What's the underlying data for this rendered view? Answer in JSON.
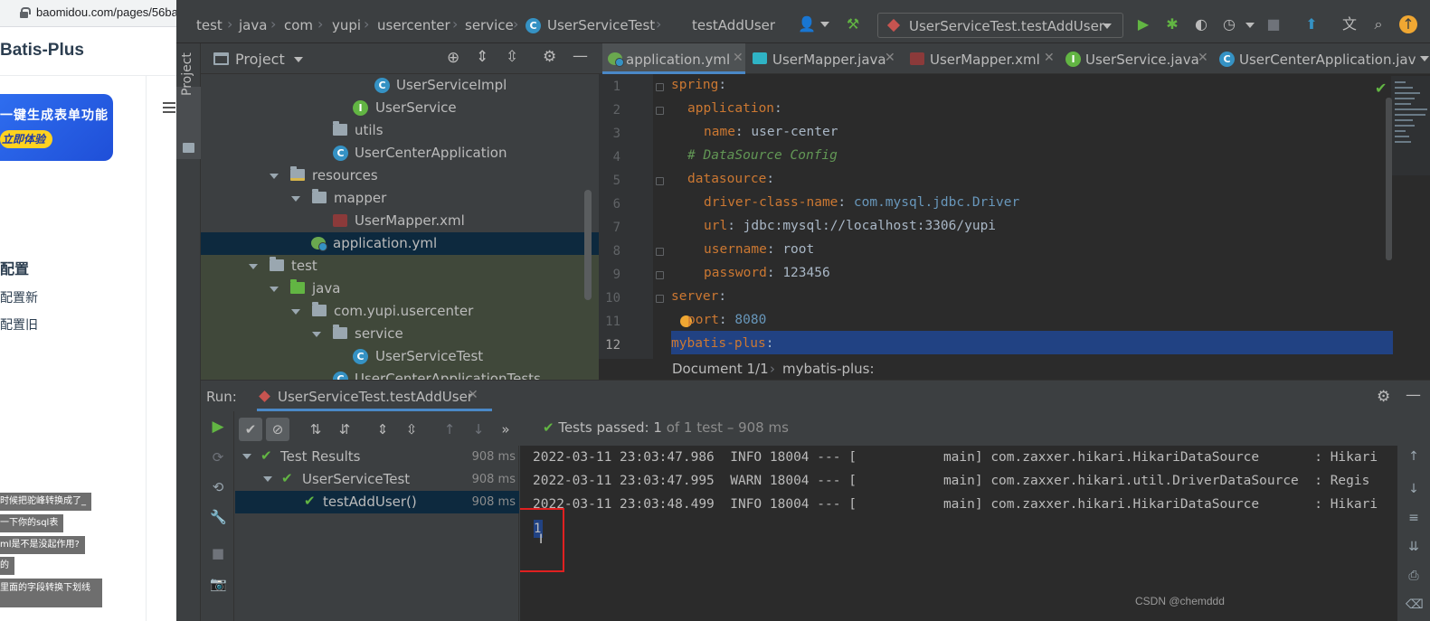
{
  "browser": {
    "url": "baomidou.com/pages/56ba",
    "brand": "Batis-Plus",
    "banner_line1": "一键生成表单功能",
    "banner_line2": "立即体验",
    "section_title": "配置",
    "links": [
      "配置新",
      "配置旧"
    ],
    "chips": [
      "时候把驼峰转换成了_",
      "一下你的sql表",
      "ml是不是没起作用?",
      "的",
      "里面的字段转换下划线"
    ]
  },
  "navbar": {
    "crumbs": [
      "test",
      "java",
      "com",
      "yupi",
      "usercenter",
      "service",
      "UserServiceTest",
      "testAddUser"
    ],
    "run_config": "UserServiceTest.testAddUser"
  },
  "project": {
    "title": "Project",
    "tool_tab": "Project",
    "tree": [
      {
        "label": "UserServiceImpl",
        "icon": "class-icon"
      },
      {
        "label": "UserService",
        "icon": "interface-icon"
      },
      {
        "label": "utils",
        "icon": "package-icon"
      },
      {
        "label": "UserCenterApplication",
        "icon": "spring-class-icon"
      },
      {
        "label": "resources",
        "icon": "resources-folder-icon"
      },
      {
        "label": "mapper",
        "icon": "folder-icon"
      },
      {
        "label": "UserMapper.xml",
        "icon": "xml-icon"
      },
      {
        "label": "application.yml",
        "icon": "yml-icon"
      },
      {
        "label": "test",
        "icon": "folder-icon"
      },
      {
        "label": "java",
        "icon": "test-folder-icon"
      },
      {
        "label": "com.yupi.usercenter",
        "icon": "package-icon"
      },
      {
        "label": "service",
        "icon": "package-icon"
      },
      {
        "label": "UserServiceTest",
        "icon": "class-icon"
      },
      {
        "label": "UserCenterApplicationTests",
        "icon": "class-icon"
      }
    ]
  },
  "editor": {
    "tabs": [
      "application.yml",
      "UserMapper.java",
      "UserMapper.xml",
      "UserService.java",
      "UserCenterApplication.jav"
    ],
    "line_numbers": [
      "1",
      "2",
      "3",
      "4",
      "5",
      "6",
      "7",
      "8",
      "9",
      "10",
      "11",
      "12"
    ],
    "code": {
      "l1k": "spring",
      "l1p": ":",
      "l2k": "application",
      "l2p": ":",
      "l3k": "name",
      "l3p": ": ",
      "l3v": "user-center",
      "l4c": "# DataSource Config",
      "l5k": "datasource",
      "l5p": ":",
      "l6k": "driver-class-name",
      "l6p": ": ",
      "l6v": "com.mysql.jdbc.Driver",
      "l7k": "url",
      "l7p": ": ",
      "l7v": "jdbc:mysql://localhost:3306/yupi",
      "l8k": "username",
      "l8p": ": ",
      "l8v": "root",
      "l9k": "password",
      "l9p": ": ",
      "l9v": "123456",
      "l10k": "server",
      "l10p": ":",
      "l11k": "port",
      "l11p": ": ",
      "l11v": "8080",
      "l12k": "mybatis-plus",
      "l12p": ":"
    },
    "breadcrumb": [
      "Document 1/1",
      "mybatis-plus:"
    ]
  },
  "run": {
    "label": "Run:",
    "tab": "UserServiceTest.testAddUser",
    "status_prefix": "Tests passed: ",
    "status_count": "1",
    "status_suffix": " of 1 test – 908 ms",
    "tree": [
      {
        "label": "Test Results",
        "ms": "908 ms"
      },
      {
        "label": "UserServiceTest",
        "ms": "908 ms"
      },
      {
        "label": "testAddUser()",
        "ms": "908 ms"
      }
    ],
    "console": [
      "2022-03-11 23:03:47.986  INFO 18004 --- [           main] com.zaxxer.hikari.HikariDataSource       : Hikari",
      "2022-03-11 23:03:47.995  WARN 18004 --- [           main] com.zaxxer.hikari.util.DriverDataSource  : Regis",
      "2022-03-11 23:03:48.499  INFO 18004 --- [           main] com.zaxxer.hikari.HikariDataSource       : Hikari"
    ],
    "output_value": "1"
  },
  "watermark": "CSDN @chemddd"
}
